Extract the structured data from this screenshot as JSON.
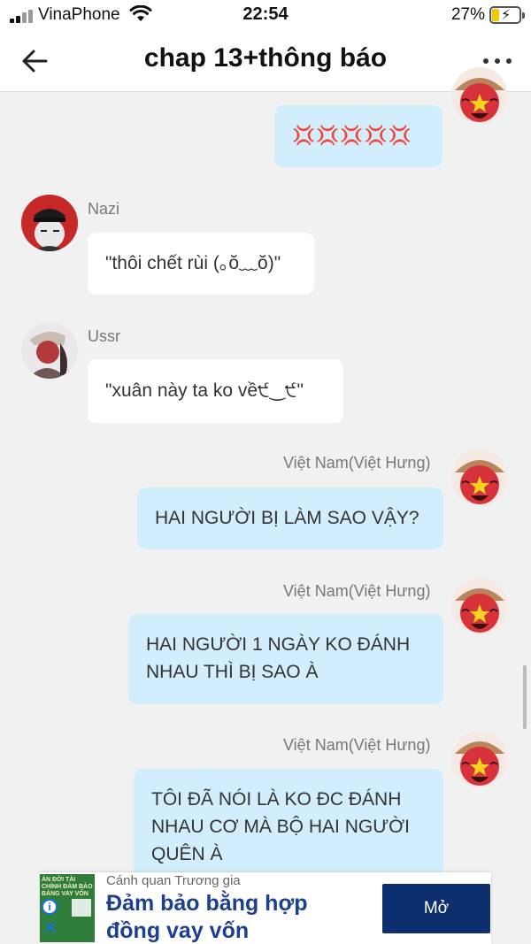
{
  "status_bar": {
    "carrier": "VinaPhone",
    "time": "22:54",
    "battery_percent": "27%",
    "battery_level": 0.27,
    "battery_charging": true,
    "icons": [
      "signal-icon",
      "wifi-icon",
      "battery-charging-icon"
    ]
  },
  "nav": {
    "title": "chap 13+thông báo",
    "back_icon": "arrow-left-icon",
    "more_icon": "more-horizontal-icon"
  },
  "messages": [
    {
      "direction": "out",
      "sender": "",
      "avatar": "vietnam-avatar",
      "lines": [
        "💢💢💢💢💢"
      ]
    },
    {
      "direction": "in",
      "sender": "Nazi",
      "avatar": "nazi-avatar",
      "lines": [
        "\"thôi chết rùi (｡ŏ﹏ŏ)\""
      ]
    },
    {
      "direction": "in",
      "sender": "Ussr",
      "avatar": "ussr-avatar",
      "lines": [
        "\"xuân này ta ko về੯‿੯\""
      ]
    },
    {
      "direction": "out",
      "sender": "Việt Nam(Việt Hưng)",
      "avatar": "vietnam-avatar",
      "lines": [
        "HAI NGƯỜI BỊ LÀM SAO VẬY?"
      ]
    },
    {
      "direction": "out",
      "sender": "Việt Nam(Việt Hưng)",
      "avatar": "vietnam-avatar",
      "lines": [
        "HAI NGƯỜI 1 NGÀY KO ĐÁNH",
        "NHAU THÌ BỊ SAO À"
      ]
    },
    {
      "direction": "out",
      "sender": "Việt Nam(Việt Hưng)",
      "avatar": "vietnam-avatar",
      "lines": [
        "TÔI ĐÃ NÓI LÀ KO ĐC ĐÁNH",
        "NHAU CƠ MÀ BỘ HAI NGƯỜI",
        "QUÊN À"
      ]
    }
  ],
  "ad": {
    "source": "Cánh quan Trương gia",
    "headline_lines": [
      "Đảm bảo bằng hợp",
      "đồng vay vốn"
    ],
    "button_label": "Mở",
    "thumb_text": "ẢN ĐỜI TÀI CHÍNH ĐẢM BẢO BẰNG VAY VỐN",
    "info_icon": "info-icon",
    "close_icon": "close-icon",
    "accent": "#0d2f6e"
  },
  "colors": {
    "chat_background": "#f1f1f1",
    "incoming_bubble": "#ffffff",
    "outgoing_bubble": "#d2eefc"
  }
}
